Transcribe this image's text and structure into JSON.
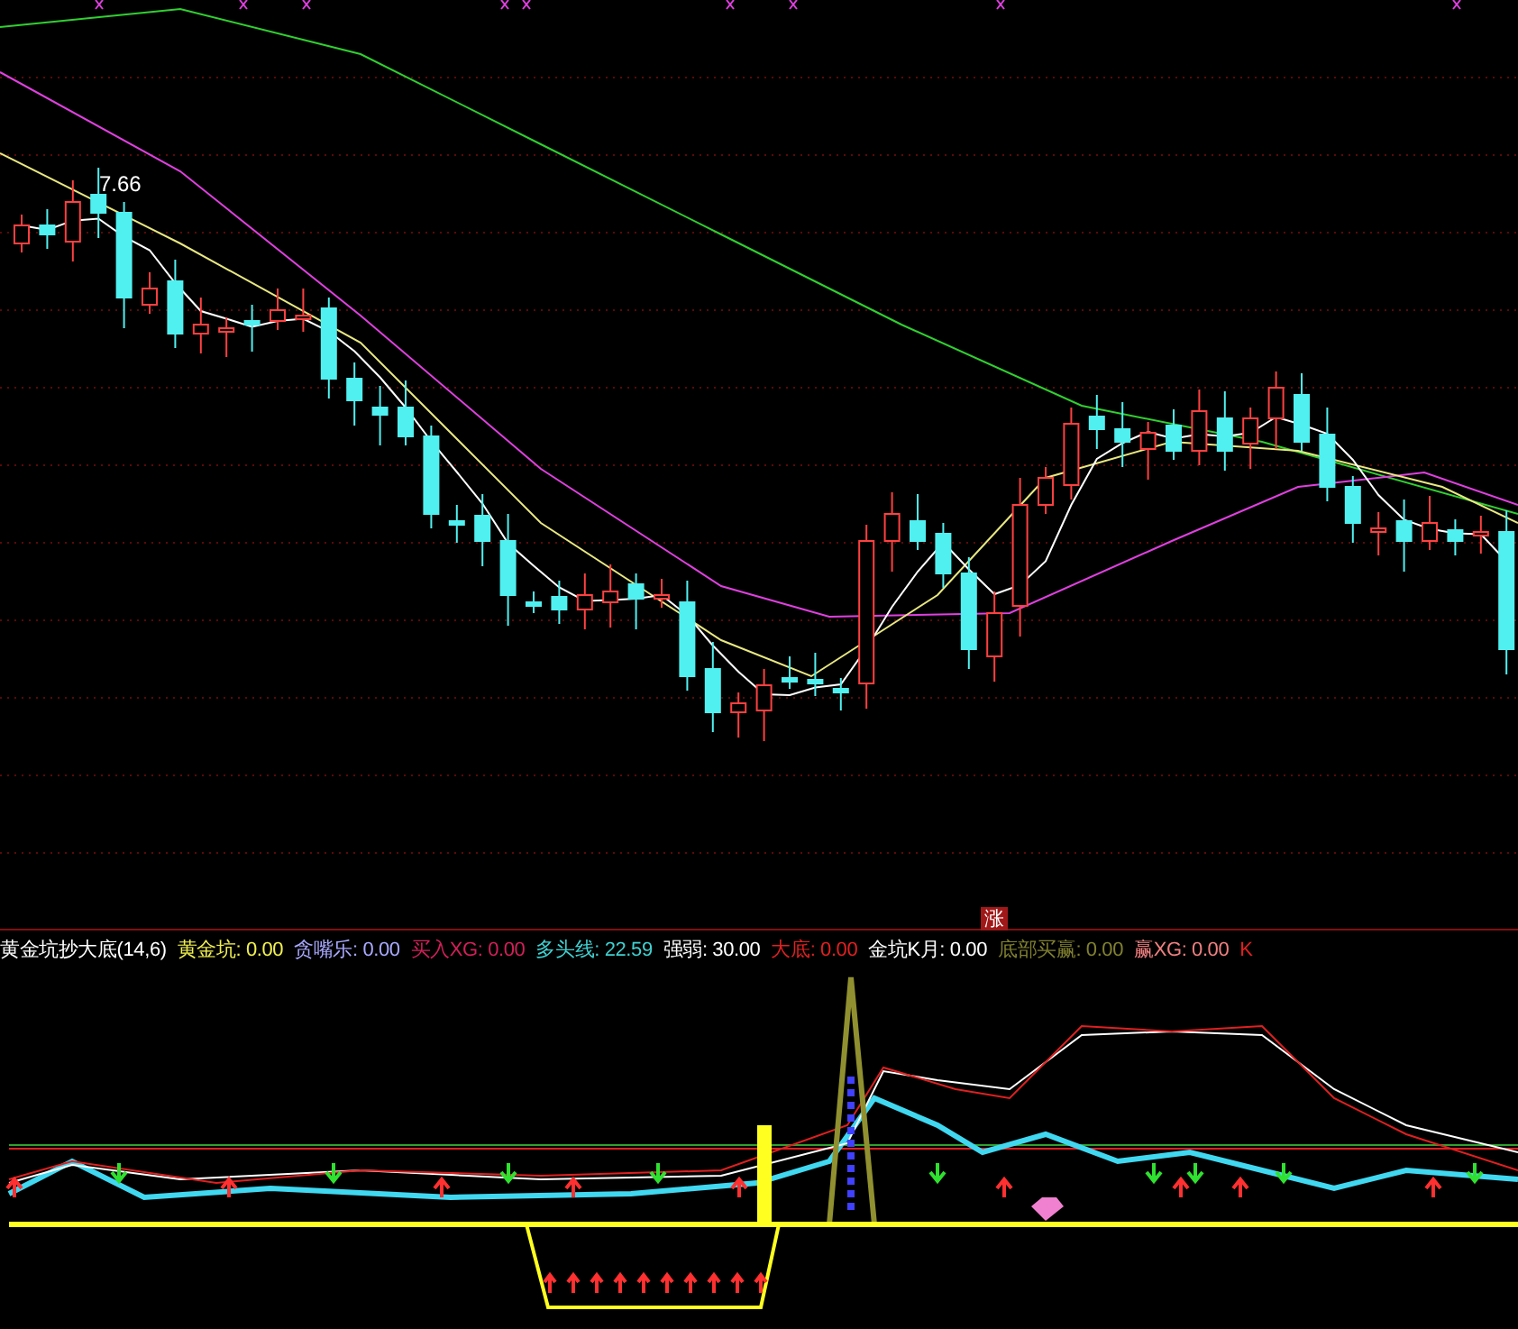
{
  "main_chart": {
    "price_label": "7.66",
    "marker": "涨"
  },
  "indicator": {
    "title": "黄金坑抄大底(14,6)",
    "items": [
      {
        "text": "黄金坑: 0.00",
        "color": "#f0f050"
      },
      {
        "text": "贪嘴乐: 0.00",
        "color": "#a8a8ff"
      },
      {
        "text": "买入XG: 0.00",
        "color": "#d0205a"
      },
      {
        "text": "多头线: 22.59",
        "color": "#40d0d0"
      },
      {
        "text": "强弱: 30.00",
        "color": "#ffffff"
      },
      {
        "text": "大底: 0.00",
        "color": "#e02020"
      },
      {
        "text": "金坑K月: 0.00",
        "color": "#ffffff"
      },
      {
        "text": "底部买赢: 0.00",
        "color": "#808030"
      },
      {
        "text": "赢XG: 0.00",
        "color": "#f08080"
      },
      {
        "text": "K",
        "color": "#e02020"
      }
    ]
  }
}
